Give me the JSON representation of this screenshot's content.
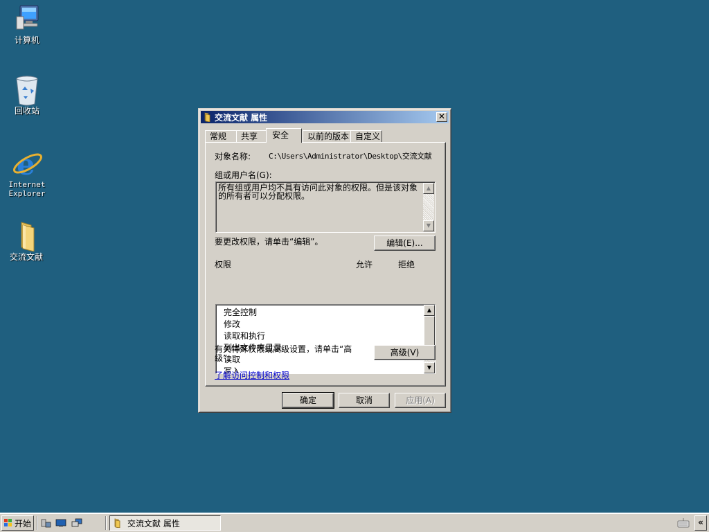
{
  "desktop": {
    "icons": [
      {
        "label": "计算机",
        "icon": "computer-icon"
      },
      {
        "label": "回收站",
        "icon": "recycle-bin-icon"
      },
      {
        "label_line1": "Internet",
        "label_line2": "Explorer",
        "icon": "internet-explorer-icon"
      },
      {
        "label": "交流文献",
        "icon": "folder-icon"
      }
    ],
    "background_color": "#1f5f7f"
  },
  "dialog": {
    "title": "交流文献 属性",
    "close_label": "✕",
    "tabs": [
      {
        "label": "常规",
        "active": false
      },
      {
        "label": "共享",
        "active": false
      },
      {
        "label": "安全",
        "active": true
      },
      {
        "label": "以前的版本",
        "active": false
      },
      {
        "label": "自定义",
        "active": false
      }
    ],
    "object_name_label": "对象名称:",
    "object_name_value": "C:\\Users\\Administrator\\Desktop\\交流文献",
    "group_label": "组或用户名(G):",
    "group_message": "所有组或用户均不具有访问此对象的权限。但是该对象的所有者可以分配权限。",
    "edit_hint": "要更改权限，请单击“编辑”。",
    "edit_button": "编辑(E)...",
    "permissions_header": "权限",
    "allow_header": "允许",
    "deny_header": "拒绝",
    "permissions": [
      "完全控制",
      "修改",
      "读取和执行",
      "列出文件夹目录",
      "读取",
      "写入"
    ],
    "advanced_hint": "有关特殊权限或高级设置，请单击“高级”。",
    "advanced_button": "高级(V)",
    "learn_link": "了解访问控制和权限",
    "ok_button": "确定",
    "cancel_button": "取消",
    "apply_button": "应用(A)"
  },
  "taskbar": {
    "start_label": "开始",
    "task_button_label": "交流文献 属性",
    "tray_chevron": "«"
  }
}
